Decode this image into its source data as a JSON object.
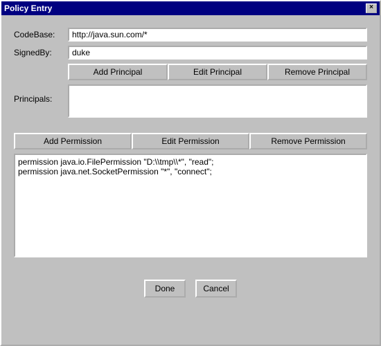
{
  "window": {
    "title": "Policy Entry",
    "close": "×"
  },
  "fields": {
    "codebase_label": "CodeBase:",
    "codebase_value": "http://java.sun.com/*",
    "signedby_label": "SignedBy:",
    "signedby_value": "duke",
    "principals_label": "Principals:"
  },
  "buttons": {
    "add_principal": "Add Principal",
    "edit_principal": "Edit Principal",
    "remove_principal": "Remove Principal",
    "add_permission": "Add Permission",
    "edit_permission": "Edit Permission",
    "remove_permission": "Remove Permission",
    "done": "Done",
    "cancel": "Cancel"
  },
  "permissions": [
    "permission java.io.FilePermission \"D:\\\\tmp\\\\*\", \"read\";",
    "permission java.net.SocketPermission \"*\", \"connect\";"
  ]
}
